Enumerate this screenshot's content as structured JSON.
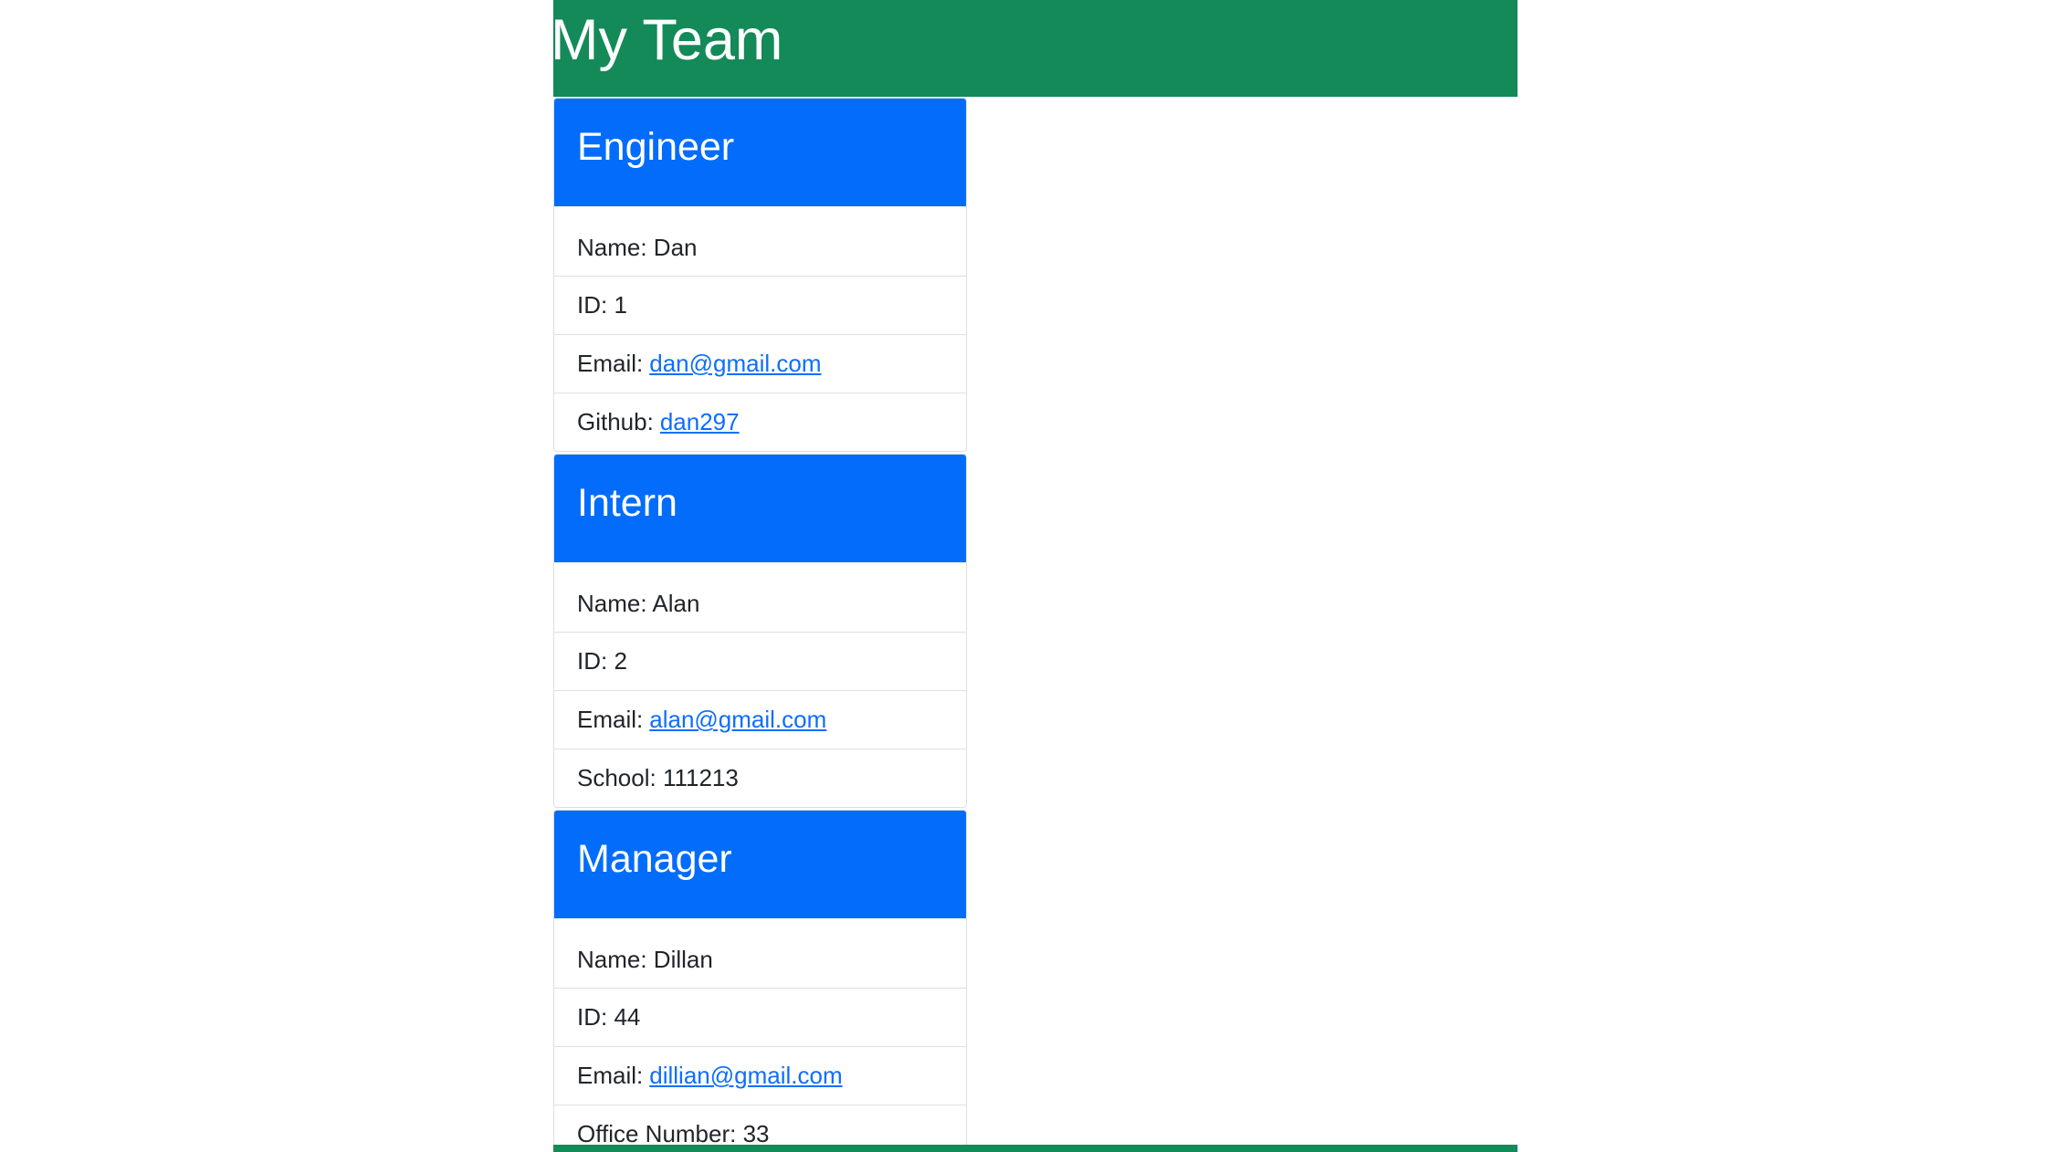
{
  "header": {
    "title": "My Team"
  },
  "colors": {
    "header_bg": "#138a58",
    "card_header_bg": "#036cfb",
    "link": "#0d6efd"
  },
  "cards": [
    {
      "role": "Engineer",
      "name": "Name: Dan",
      "id": "ID: 1",
      "email_label": "Email:",
      "email": "dan@gmail.com",
      "extra_label": "Github:",
      "extra_value": "dan297"
    },
    {
      "role": "Intern",
      "name": "Name: Alan",
      "id": "ID: 2",
      "email_label": "Email:",
      "email": "alan@gmail.com",
      "extra": "School: 111213"
    },
    {
      "role": "Manager",
      "name": "Name: Dillan",
      "id": "ID: 44",
      "email_label": "Email:",
      "email": "dillian@gmail.com",
      "extra": "Office Number: 33"
    }
  ]
}
